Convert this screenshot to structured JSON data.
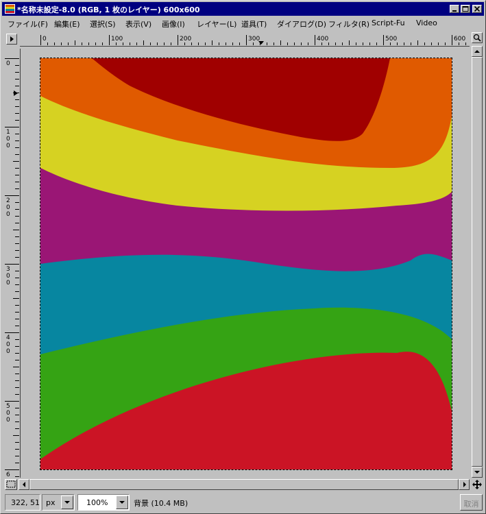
{
  "window": {
    "title": "*名称未設定-8.0 (RGB, 1 枚のレイヤー) 600x600"
  },
  "menu": [
    {
      "label": "ファイル(F)",
      "name": "menu-file"
    },
    {
      "label": "編集(E)",
      "name": "menu-edit"
    },
    {
      "label": "選択(S)",
      "name": "menu-select"
    },
    {
      "label": "表示(V)",
      "name": "menu-view"
    },
    {
      "label": "画像(I)",
      "name": "menu-image"
    },
    {
      "label": "レイヤー(L)",
      "name": "menu-layer"
    },
    {
      "label": "道具(T)",
      "name": "menu-tools"
    },
    {
      "label": "ダイアログ(D)",
      "name": "menu-dialogs"
    },
    {
      "label": "フィルタ(R)",
      "name": "menu-filters"
    },
    {
      "label": "Script-Fu",
      "name": "menu-script-fu"
    },
    {
      "label": "Video",
      "name": "menu-video"
    }
  ],
  "rulers": {
    "horizontal_labels": [
      "0",
      "100",
      "200",
      "300",
      "400",
      "500",
      "600"
    ],
    "vertical_labels": [
      "0",
      "100",
      "200",
      "300",
      "400",
      "500",
      "6"
    ]
  },
  "canvas": {
    "band_colors": {
      "dark_red": "#a00000",
      "orange": "#e05a00",
      "yellow": "#d6d222",
      "purple": "#9a1675",
      "teal": "#0786a0",
      "green": "#35a314",
      "red": "#cb1425"
    }
  },
  "status": {
    "cursor_position": "322, 51",
    "unit": "px",
    "zoom": "100%",
    "layer_info": "背景 (10.4 MB)",
    "cancel_label": "取消"
  }
}
